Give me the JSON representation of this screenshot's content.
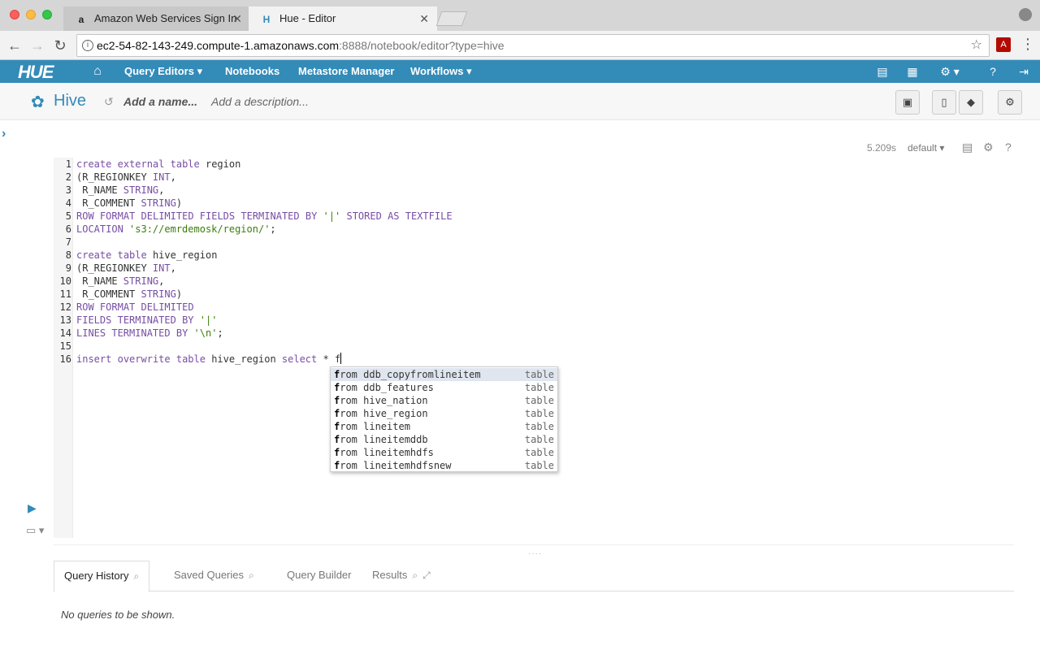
{
  "browser": {
    "tabs": [
      {
        "title": "Amazon Web Services Sign In",
        "favicon": "a",
        "close": "✕"
      },
      {
        "title": "Hue - Editor",
        "favicon": "H",
        "close": "✕"
      }
    ],
    "url_host": "ec2-54-82-143-249.compute-1.amazonaws.com",
    "url_rest": ":8888/notebook/editor?type=hive"
  },
  "hue_nav": {
    "logo": "HUE",
    "items": [
      "Query Editors",
      "Notebooks",
      "Metastore Manager",
      "Workflows"
    ]
  },
  "editor_header": {
    "app_title": "Hive",
    "name_placeholder": "Add a name...",
    "description_placeholder": "Add a description..."
  },
  "snippet": {
    "exec_time": "5.209s",
    "database": "default"
  },
  "code_lines": [
    "create external table region",
    "(R_REGIONKEY INT,",
    " R_NAME STRING,",
    " R_COMMENT STRING)",
    "ROW FORMAT DELIMITED FIELDS TERMINATED BY '|' STORED AS TEXTFILE",
    "LOCATION 's3://emrdemosk/region/';",
    "",
    "create table hive_region",
    "(R_REGIONKEY INT,",
    " R_NAME STRING,",
    " R_COMMENT STRING)",
    "ROW FORMAT DELIMITED",
    "FIELDS TERMINATED BY '|'",
    "LINES TERMINATED BY '\\n';",
    "",
    "insert overwrite table hive_region select * f"
  ],
  "line_numbers": [
    "1",
    "2",
    "3",
    "4",
    "5",
    "6",
    "7",
    "8",
    "9",
    "10",
    "11",
    "12",
    "13",
    "14",
    "15",
    "16"
  ],
  "autocomplete": {
    "items": [
      {
        "match": "f",
        "rest": "rom ddb_copyfromlineitem",
        "meta": "table"
      },
      {
        "match": "f",
        "rest": "rom ddb_features",
        "meta": "table"
      },
      {
        "match": "f",
        "rest": "rom hive_nation",
        "meta": "table"
      },
      {
        "match": "f",
        "rest": "rom hive_region",
        "meta": "table"
      },
      {
        "match": "f",
        "rest": "rom lineitem",
        "meta": "table"
      },
      {
        "match": "f",
        "rest": "rom lineitemddb",
        "meta": "table"
      },
      {
        "match": "f",
        "rest": "rom lineitemhdfs",
        "meta": "table"
      },
      {
        "match": "f",
        "rest": "rom lineitemhdfsnew",
        "meta": "table"
      }
    ]
  },
  "bottom_tabs": [
    "Query History",
    "Saved Queries",
    "Query Builder",
    "Results"
  ],
  "empty_message": "No queries to be shown.",
  "colors": {
    "hue_blue": "#338bb8",
    "keyword": "#774ea5",
    "string": "#3b7d0b"
  }
}
